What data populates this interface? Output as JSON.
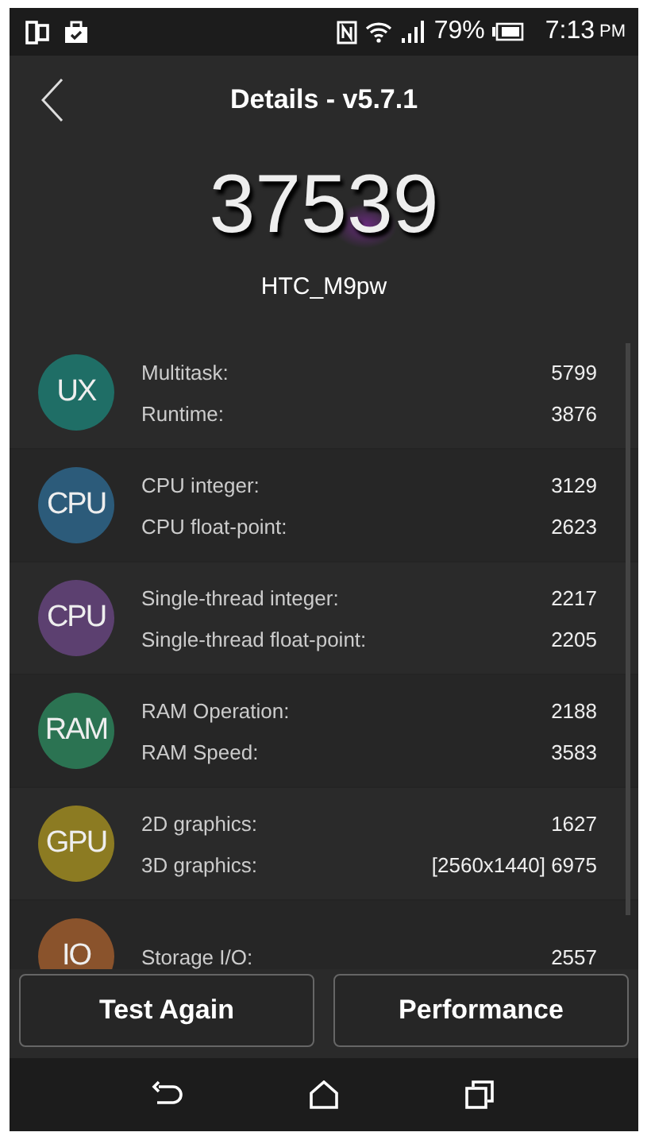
{
  "status_bar": {
    "battery_text": "79%",
    "time": "7:13",
    "ampm": "PM"
  },
  "header": {
    "title": "Details - v5.7.1"
  },
  "score": "37539",
  "device": "HTC_M9pw",
  "categories": [
    {
      "badge": "UX",
      "color": "#1f6e66",
      "tests": [
        {
          "name": "Multitask:",
          "value": "5799"
        },
        {
          "name": "Runtime:",
          "value": "3876"
        }
      ]
    },
    {
      "badge": "CPU",
      "color": "#2c5b7a",
      "tests": [
        {
          "name": "CPU integer:",
          "value": "3129"
        },
        {
          "name": "CPU float-point:",
          "value": "2623"
        }
      ]
    },
    {
      "badge": "CPU",
      "color": "#5c4070",
      "tests": [
        {
          "name": "Single-thread integer:",
          "value": "2217"
        },
        {
          "name": "Single-thread float-point:",
          "value": "2205"
        }
      ]
    },
    {
      "badge": "RAM",
      "color": "#2b7352",
      "tests": [
        {
          "name": "RAM Operation:",
          "value": "2188"
        },
        {
          "name": "RAM Speed:",
          "value": "3583"
        }
      ]
    },
    {
      "badge": "GPU",
      "color": "#8c7b22",
      "tests": [
        {
          "name": "2D graphics:",
          "value": "1627"
        },
        {
          "name": "3D graphics:",
          "value": "[2560x1440] 6975"
        }
      ]
    },
    {
      "badge": "IO",
      "color": "#8a532c",
      "tests": [
        {
          "name": "Storage I/O:",
          "value": "2557"
        }
      ]
    }
  ],
  "buttons": [
    "Test Again",
    "Performance"
  ]
}
